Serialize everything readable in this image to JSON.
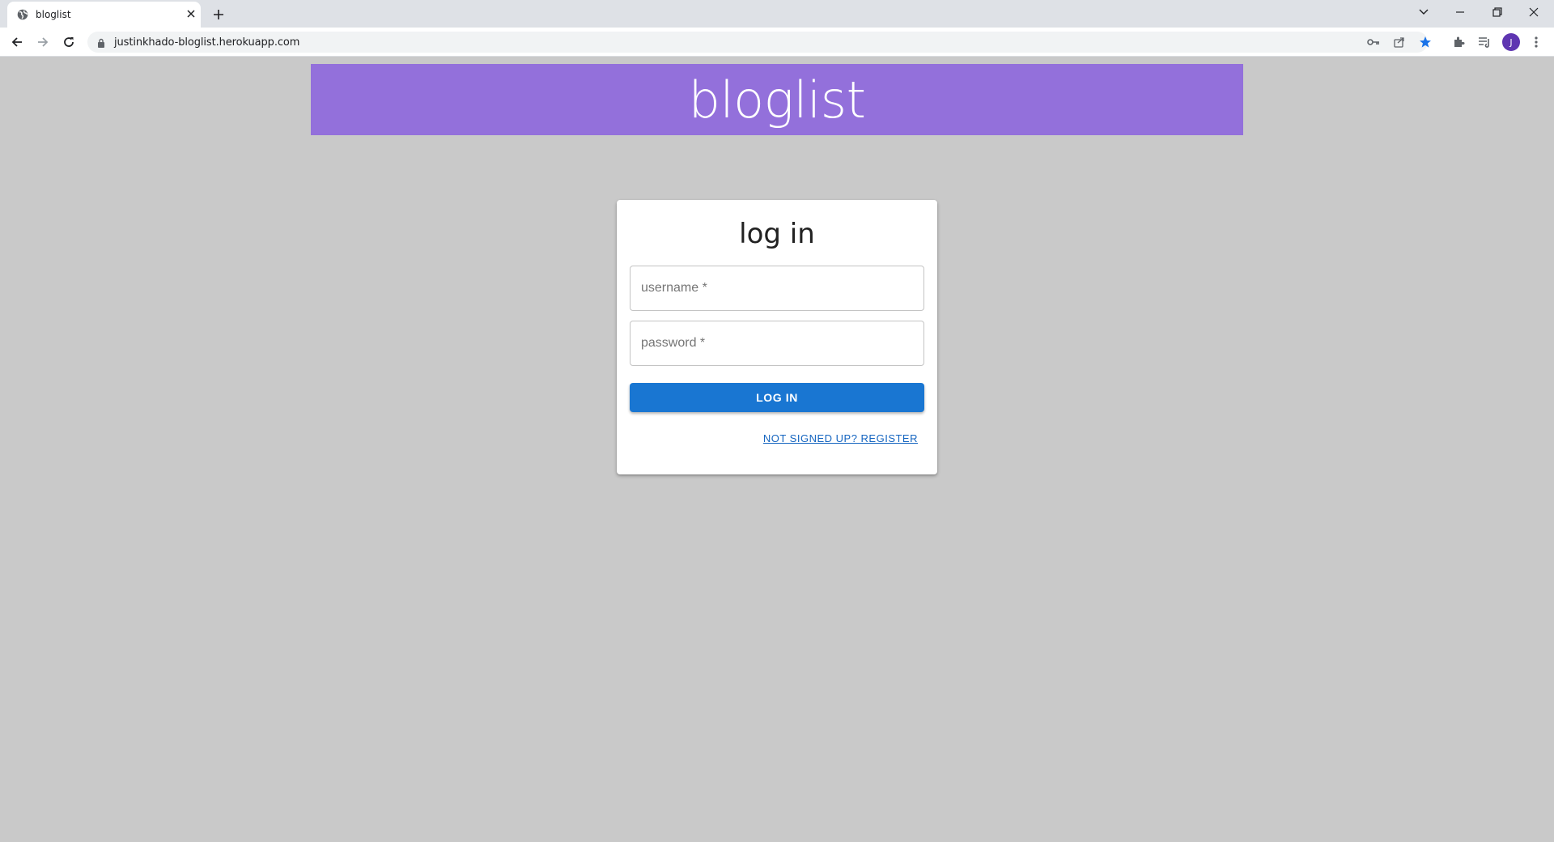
{
  "browser": {
    "tab_title": "bloglist",
    "url": "justinkhado-bloglist.herokuapp.com",
    "avatar_letter": "J",
    "avatar_color": "#5e35b1",
    "bookmark_star_color": "#1a73e8"
  },
  "page": {
    "header_title": "bloglist",
    "header_color": "#9370db",
    "background_color": "#c9c9c9"
  },
  "login_form": {
    "title": "log in",
    "username_placeholder": "username *",
    "password_placeholder": "password *",
    "submit_label": "LOG IN",
    "submit_color": "#1976d2",
    "register_link": "NOT SIGNED UP? REGISTER"
  },
  "icons": {
    "tab_favicon": "globe-icon",
    "tab_close": "close-icon",
    "new_tab": "plus-icon",
    "back": "arrow-left-icon",
    "forward": "arrow-right-icon",
    "reload": "reload-icon",
    "lock": "lock-icon",
    "key": "key-icon",
    "share": "share-icon",
    "bookmark": "star-icon",
    "extensions": "puzzle-icon",
    "reading_list": "reading-list-icon",
    "menu": "kebab-menu-icon"
  }
}
